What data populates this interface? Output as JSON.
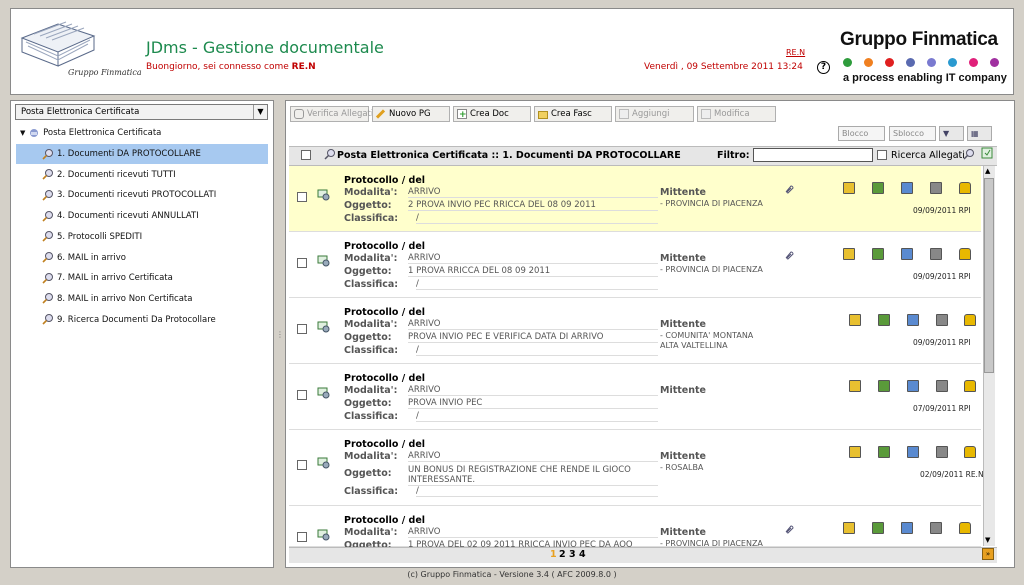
{
  "header": {
    "app_title": "JDms - Gestione documentale",
    "greeting": "Buongiorno, sei connesso come",
    "user": "RE.N",
    "user_link": "RE.N",
    "datetime": "Venerdì , 09 Settembre 2011 13:24",
    "help": "?",
    "brand": "Gruppo Finmatica",
    "tagline": "a process enabling IT company",
    "logo_caption": "Gruppo Finmatica",
    "dot_colors": [
      "#2e9c3c",
      "#f08020",
      "#e02020",
      "#5a6ab0",
      "#7a7ad0",
      "#2a9ad0",
      "#e0207a",
      "#a030a0"
    ]
  },
  "sidebar": {
    "select_value": "Posta Elettronica Certificata",
    "root": "Posta Elettronica Certificata",
    "items": [
      {
        "label": "1. Documenti DA PROTOCOLLARE",
        "selected": true
      },
      {
        "label": "2. Documenti ricevuti TUTTI"
      },
      {
        "label": "3. Documenti ricevuti PROTOCOLLATI"
      },
      {
        "label": "4. Documenti ricevuti ANNULLATI"
      },
      {
        "label": "5. Protocolli SPEDITI"
      },
      {
        "label": "6. MAIL in arrivo"
      },
      {
        "label": "7. MAIL in arrivo Certificata"
      },
      {
        "label": "8. MAIL in arrivo Non Certificata"
      },
      {
        "label": "9. Ricerca Documenti Da Protocollare"
      }
    ]
  },
  "toolbar": {
    "verifica": "Verifica Allegati",
    "nuovo_pg": "Nuovo PG",
    "crea_doc": "Crea Doc",
    "crea_fasc": "Crea Fasc",
    "aggiungi": "Aggiungi",
    "modifica": "Modifica",
    "blocco": "Blocco",
    "sblocco": "Sblocco"
  },
  "list": {
    "title": "Posta Elettronica Certificata :: 1. Documenti DA PROTOCOLLARE",
    "filter_label": "Filtro:",
    "ricerca_label": "Ricerca Allegati",
    "labels": {
      "protocollo": "Protocollo  /  del",
      "modalita": "Modalita':",
      "oggetto": "Oggetto:",
      "classifica": "Classifica:",
      "mittente": "Mittente"
    },
    "rows": [
      {
        "modalita": "ARRIVO",
        "oggetto": "2 PROVA INVIO PEC RRICCA DEL 08 09 2011",
        "classifica": "/",
        "mittente": "- PROVINCIA DI PIACENZA",
        "date": "09/09/2011 RPI",
        "attach": true
      },
      {
        "modalita": "ARRIVO",
        "oggetto": "1 PROVA RRICCA DEL 08 09 2011",
        "classifica": "/",
        "mittente": "- PROVINCIA DI PIACENZA",
        "date": "09/09/2011 RPI",
        "attach": true
      },
      {
        "modalita": "ARRIVO",
        "oggetto": "PROVA INVIO PEC E VERIFICA DATA DI ARRIVO",
        "classifica": "/",
        "mittente": "- COMUNITA' MONTANA ALTA VALTELLINA",
        "date": "09/09/2011 RPI",
        "attach": false
      },
      {
        "modalita": "ARRIVO",
        "oggetto": "PROVA INVIO PEC",
        "classifica": "/",
        "mittente": "",
        "date": "07/09/2011 RPI",
        "attach": false
      },
      {
        "modalita": "ARRIVO",
        "oggetto": "UN BONUS DI REGISTRAZIONE CHE RENDE IL GIOCO INTERESSANTE.",
        "classifica": "/",
        "mittente": "- ROSALBA",
        "date": "02/09/2011 RE.N",
        "attach": false
      },
      {
        "modalita": "ARRIVO",
        "oggetto": "1 PROVA DEL 02 09 2011 RRICCA INVIO PEC DA AOO",
        "classifica": "",
        "mittente": "- PROVINCIA DI PIACENZA",
        "date": "",
        "attach": true
      }
    ]
  },
  "pager": {
    "current": "1",
    "pages": [
      "2",
      "3",
      "4"
    ]
  },
  "footer": "(c) Gruppo Finmatica - Versione 3.4  ( AFC 2009.8.0 )"
}
